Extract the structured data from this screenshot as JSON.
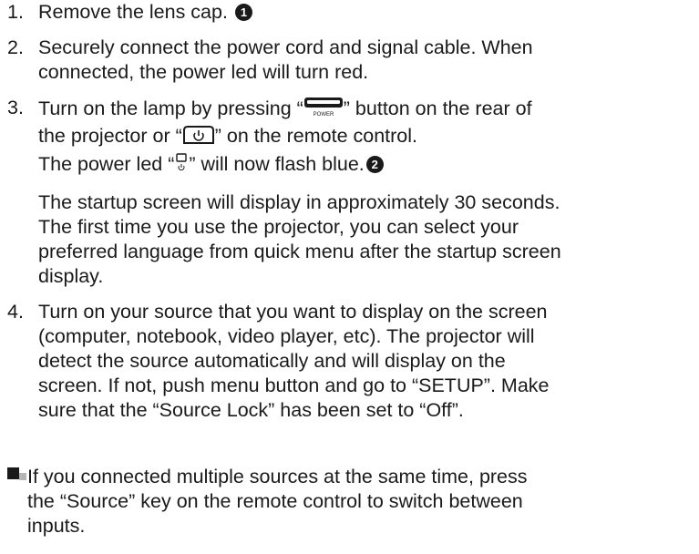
{
  "steps": [
    {
      "number": "1.",
      "line1": "Remove the lens cap.",
      "callout": "1"
    },
    {
      "number": "2.",
      "line1": "Securely connect the power cord and signal cable. When",
      "line2": "connected, the power led will turn red."
    },
    {
      "number": "3.",
      "a_pre": "Turn on the lamp by pressing “",
      "a_post": "” button on the rear of",
      "b_pre": "the projector or “",
      "b_post": "” on the remote control.",
      "c_pre": "The power led “",
      "c_post": "” will now flash blue.",
      "callout": "2",
      "power_button_caption": "POWER",
      "para": [
        "The startup screen will display in approximately 30 seconds.",
        "The first time you use the projector, you can select your",
        "preferred language from quick menu after the startup screen",
        "display."
      ]
    },
    {
      "number": "4.",
      "lines": [
        "Turn on your source that you want to display on the screen",
        "(computer, notebook, video player, etc). The projector will",
        "detect the source automatically and will display on the",
        "screen. If not, push menu button and go to “SETUP”. Make",
        "sure that the “Source Lock” has been set to “Off”."
      ]
    }
  ],
  "note": {
    "lines": [
      "If you connected multiple sources at the same time, press",
      "the “Source” key on the remote control to switch between",
      "inputs."
    ]
  },
  "icons": {
    "power_button": "projector-power-button-icon",
    "remote_power": "remote-power-button-icon",
    "power_led": "power-led-icon",
    "note_marker": "note-bullet-icon"
  },
  "colors": {
    "text": "#1a1a1a",
    "note_small_square": "#b5b5b5"
  }
}
